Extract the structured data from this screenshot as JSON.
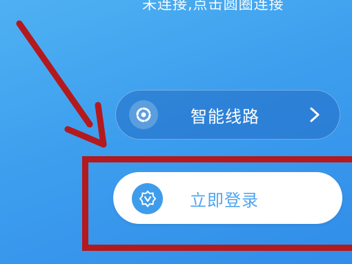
{
  "status": {
    "text": "未连接,点击圆圈连接"
  },
  "route_button": {
    "label": "智能线路",
    "icon": "swirl-icon",
    "chevron_icon": "chevron-right-icon"
  },
  "login_button": {
    "label": "立即登录",
    "icon": "badge-v-icon"
  },
  "annotation": {
    "color": "#b3191d",
    "arrow_icon": "arrow-pointer"
  },
  "colors": {
    "background": "#3d9eee",
    "login_text": "#4fa6ee",
    "login_icon_bg": "#3f9ceb"
  }
}
